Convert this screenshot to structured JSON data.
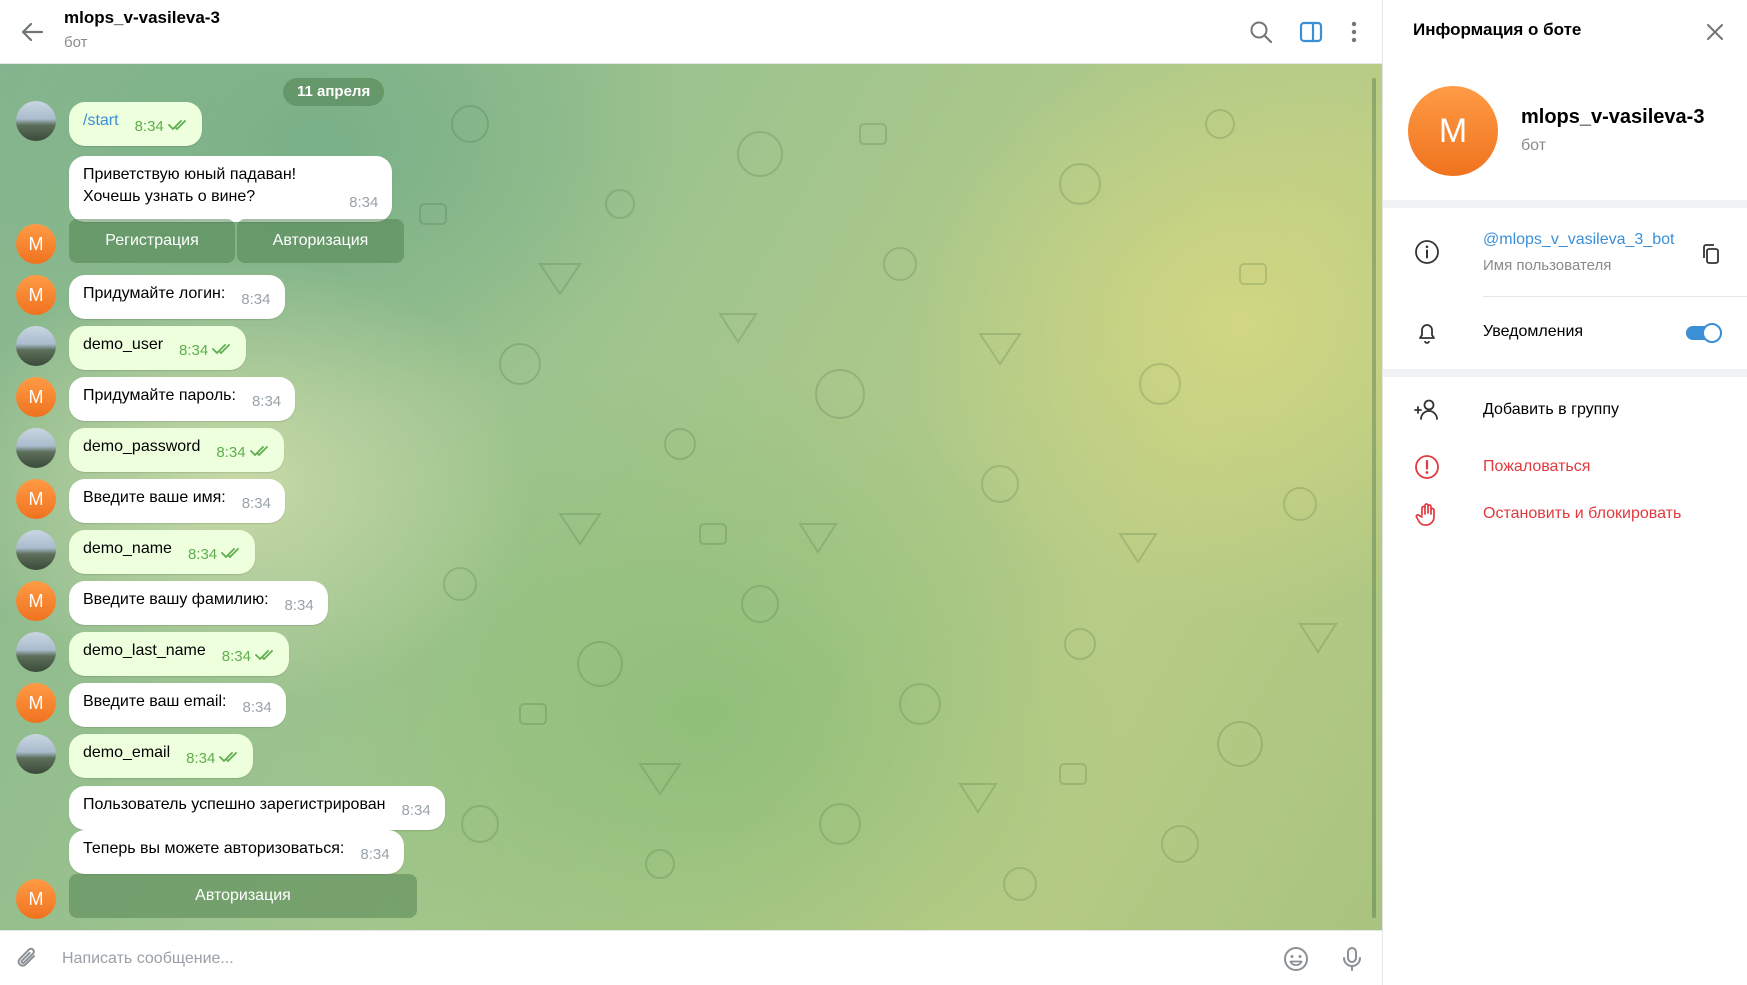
{
  "header": {
    "title": "mlops_v-vasileva-3",
    "subtitle": "бот"
  },
  "chat": {
    "date": "11 апреля",
    "messages": [
      {
        "text": "/start",
        "time": "8:34",
        "outgoing": true
      },
      {
        "text_line1": "Приветствую юный падаван!",
        "text_line2": "Хочешь узнать о вине?",
        "time": "8:34",
        "outgoing": false
      },
      {
        "text": "Придумайте логин:",
        "time": "8:34",
        "outgoing": false
      },
      {
        "text": "demo_user",
        "time": "8:34",
        "outgoing": true
      },
      {
        "text": "Придумайте пароль:",
        "time": "8:34",
        "outgoing": false
      },
      {
        "text": "demo_password",
        "time": "8:34",
        "outgoing": true
      },
      {
        "text": "Введите ваше имя:",
        "time": "8:34",
        "outgoing": false
      },
      {
        "text": "demo_name",
        "time": "8:34",
        "outgoing": true
      },
      {
        "text": "Введите вашу фамилию:",
        "time": "8:34",
        "outgoing": false
      },
      {
        "text": "demo_last_name",
        "time": "8:34",
        "outgoing": true
      },
      {
        "text": "Введите ваш email:",
        "time": "8:34",
        "outgoing": false
      },
      {
        "text": "demo_email",
        "time": "8:34",
        "outgoing": true
      },
      {
        "text": "Пользователь успешно зарегистрирован",
        "time": "8:34",
        "outgoing": false
      },
      {
        "text": "Теперь вы можете авторизоваться:",
        "time": "8:34",
        "outgoing": false
      }
    ],
    "keyboard1": [
      "Регистрация",
      "Авторизация"
    ],
    "keyboard2": [
      "Авторизация"
    ],
    "bot_avatar_letter": "M"
  },
  "composer": {
    "placeholder": "Написать сообщение..."
  },
  "panel": {
    "title": "Информация о боте",
    "name": "mlops_v-vasileva-3",
    "status": "бот",
    "avatar_letter": "M",
    "username": "@mlops_v_vasileva_3_bot",
    "username_caption": "Имя пользователя",
    "notifications_label": "Уведомления",
    "notifications_on": true,
    "add_to_group": "Добавить в группу",
    "report": "Пожаловаться",
    "block": "Остановить и блокировать"
  },
  "colors": {
    "accent": "#3a8fd6",
    "danger": "#e0393e",
    "outgoing_bubble": "#eeffde",
    "bot_avatar": "#f58a30"
  }
}
